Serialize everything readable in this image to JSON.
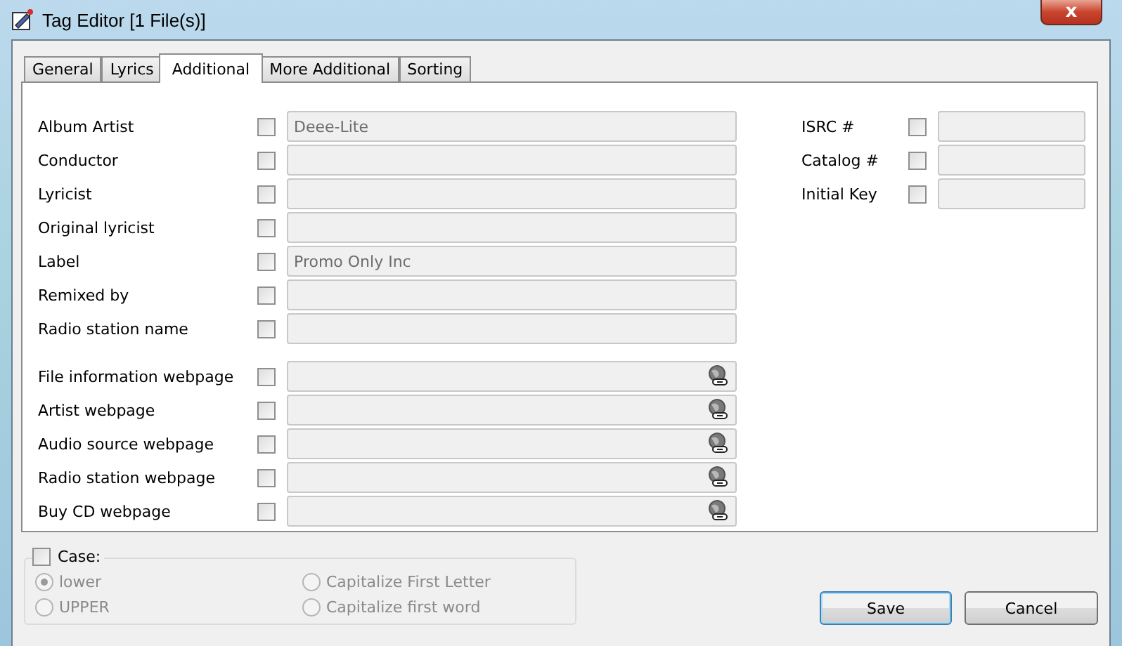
{
  "window": {
    "title": "Tag Editor [1 File(s)]",
    "close": "x"
  },
  "tabs": [
    {
      "label": "General",
      "selected": false
    },
    {
      "label": "Lyrics",
      "selected": false
    },
    {
      "label": "Additional",
      "selected": true
    },
    {
      "label": "More Additional",
      "selected": false
    },
    {
      "label": "Sorting",
      "selected": false
    }
  ],
  "left_fields": [
    {
      "label": "Album Artist",
      "kind": "text",
      "checked": false,
      "value": "Deee-Lite"
    },
    {
      "label": "Conductor",
      "kind": "text",
      "checked": false
    },
    {
      "label": "Lyricist",
      "kind": "text",
      "checked": false
    },
    {
      "label": "Original lyricist",
      "kind": "text",
      "checked": false
    },
    {
      "label": "Label",
      "kind": "text",
      "checked": false,
      "value": "Promo Only Inc"
    },
    {
      "label": "Remixed by",
      "kind": "text",
      "checked": false
    },
    {
      "label": "Radio station name",
      "kind": "text",
      "checked": false
    }
  ],
  "web_fields": [
    {
      "label": "File information webpage",
      "kind": "web",
      "checked": false
    },
    {
      "label": "Artist webpage",
      "kind": "web",
      "checked": false
    },
    {
      "label": "Audio source webpage",
      "kind": "web",
      "checked": false
    },
    {
      "label": "Radio station webpage",
      "kind": "web",
      "checked": false
    },
    {
      "label": "Buy CD webpage",
      "kind": "web",
      "checked": false
    }
  ],
  "right_fields": [
    {
      "label": "ISRC #",
      "kind": "text",
      "checked": false
    },
    {
      "label": "Catalog #",
      "kind": "text",
      "checked": false
    },
    {
      "label": "Initial Key",
      "kind": "text",
      "checked": false
    }
  ],
  "case": {
    "label": "Case:",
    "checked": false,
    "options": [
      {
        "label": "lower",
        "selected": true
      },
      {
        "label": "UPPER",
        "selected": false
      },
      {
        "label": "Capitalize First Letter",
        "selected": false
      },
      {
        "label": "Capitalize first word",
        "selected": false
      }
    ]
  },
  "buttons": [
    "Save",
    "Cancel"
  ]
}
